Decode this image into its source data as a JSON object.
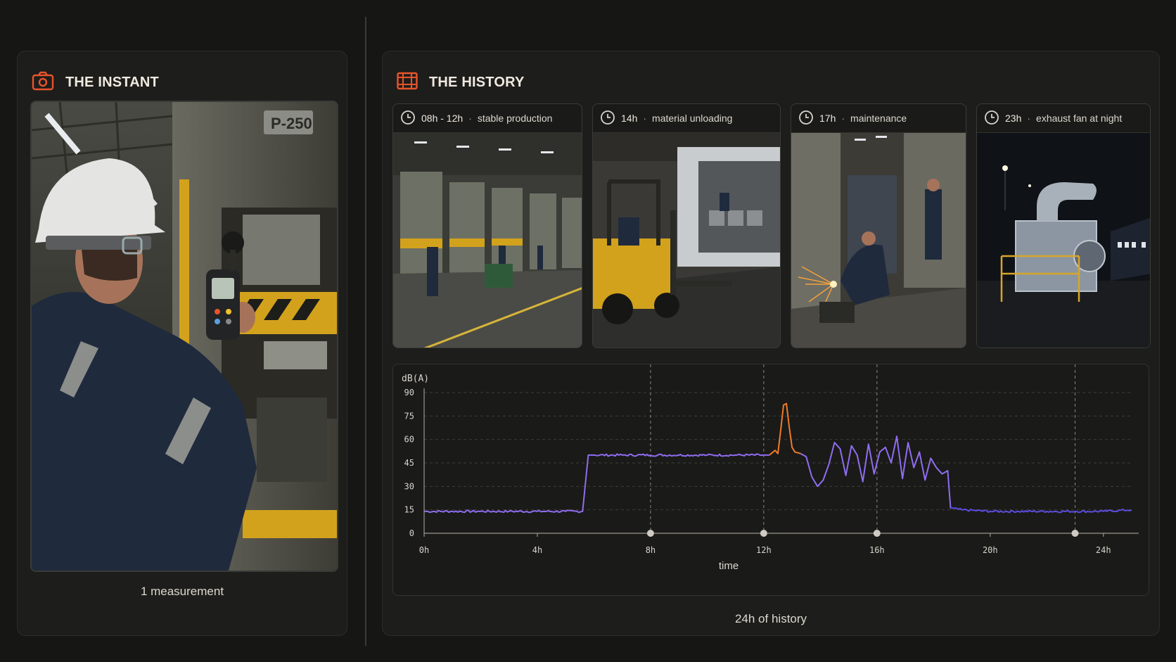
{
  "instant": {
    "title": "THE INSTANT",
    "icon": "camera-icon",
    "footer": "1 measurement"
  },
  "history": {
    "title": "THE HISTORY",
    "icon": "film-strip-icon",
    "footer": "24h of history",
    "scenes": [
      {
        "time": "08h - 12h",
        "label": "stable production"
      },
      {
        "time": "14h",
        "label": "material unloading"
      },
      {
        "time": "17h",
        "label": "maintenance"
      },
      {
        "time": "23h",
        "label": "exhaust fan at night"
      }
    ]
  },
  "colors": {
    "accent": "#e8542b",
    "series_normal": "#8f6df0",
    "series_low": "#5b4ee0",
    "series_spike": "#f07a2a"
  },
  "chart_data": {
    "type": "line",
    "ylabel": "dB(A)",
    "xlabel": "time",
    "ylim": [
      0,
      90
    ],
    "yticks": [
      0,
      15,
      30,
      45,
      60,
      75,
      90
    ],
    "xlim": [
      0,
      25
    ],
    "xticks": [
      {
        "v": 0,
        "label": "0h"
      },
      {
        "v": 4,
        "label": "4h"
      },
      {
        "v": 8,
        "label": "8h"
      },
      {
        "v": 12,
        "label": "12h"
      },
      {
        "v": 16,
        "label": "16h"
      },
      {
        "v": 20,
        "label": "20h"
      },
      {
        "v": 24,
        "label": "24h"
      }
    ],
    "markers": [
      8,
      12,
      16,
      23
    ],
    "grid": true,
    "series": [
      {
        "color_key": "series_normal",
        "x": [
          0,
          1,
          2,
          3,
          4,
          5,
          5.6,
          5.8,
          6,
          7,
          8,
          9,
          10,
          11,
          12,
          12.2
        ],
        "y": [
          14,
          14,
          14,
          14,
          14,
          14,
          14,
          50,
          50,
          50,
          50,
          50,
          50,
          50,
          50,
          50
        ]
      },
      {
        "color_key": "series_spike",
        "x": [
          12.2,
          12.4,
          12.5,
          12.6,
          12.7,
          12.8,
          12.9,
          13.0,
          13.1,
          13.3
        ],
        "y": [
          50,
          53,
          51,
          66,
          82,
          83,
          68,
          55,
          52,
          51
        ]
      },
      {
        "color_key": "series_normal",
        "x": [
          13.3,
          13.5,
          13.7,
          13.9,
          14.1,
          14.3,
          14.5,
          14.7,
          14.9,
          15.1,
          15.3,
          15.5,
          15.7,
          15.9,
          16.1,
          16.3,
          16.5,
          16.7,
          16.9,
          17.1,
          17.3,
          17.5,
          17.7,
          17.9,
          18.1,
          18.3,
          18.5,
          18.6
        ],
        "y": [
          51,
          49,
          36,
          30,
          34,
          44,
          58,
          54,
          37,
          56,
          50,
          33,
          57,
          38,
          52,
          55,
          45,
          62,
          35,
          58,
          42,
          52,
          34,
          48,
          42,
          38,
          40,
          16
        ]
      },
      {
        "color_key": "series_low",
        "x": [
          18.6,
          19,
          20,
          21,
          22,
          23,
          24,
          25
        ],
        "y": [
          16,
          15,
          14,
          14,
          14,
          14,
          14,
          15
        ]
      }
    ]
  }
}
